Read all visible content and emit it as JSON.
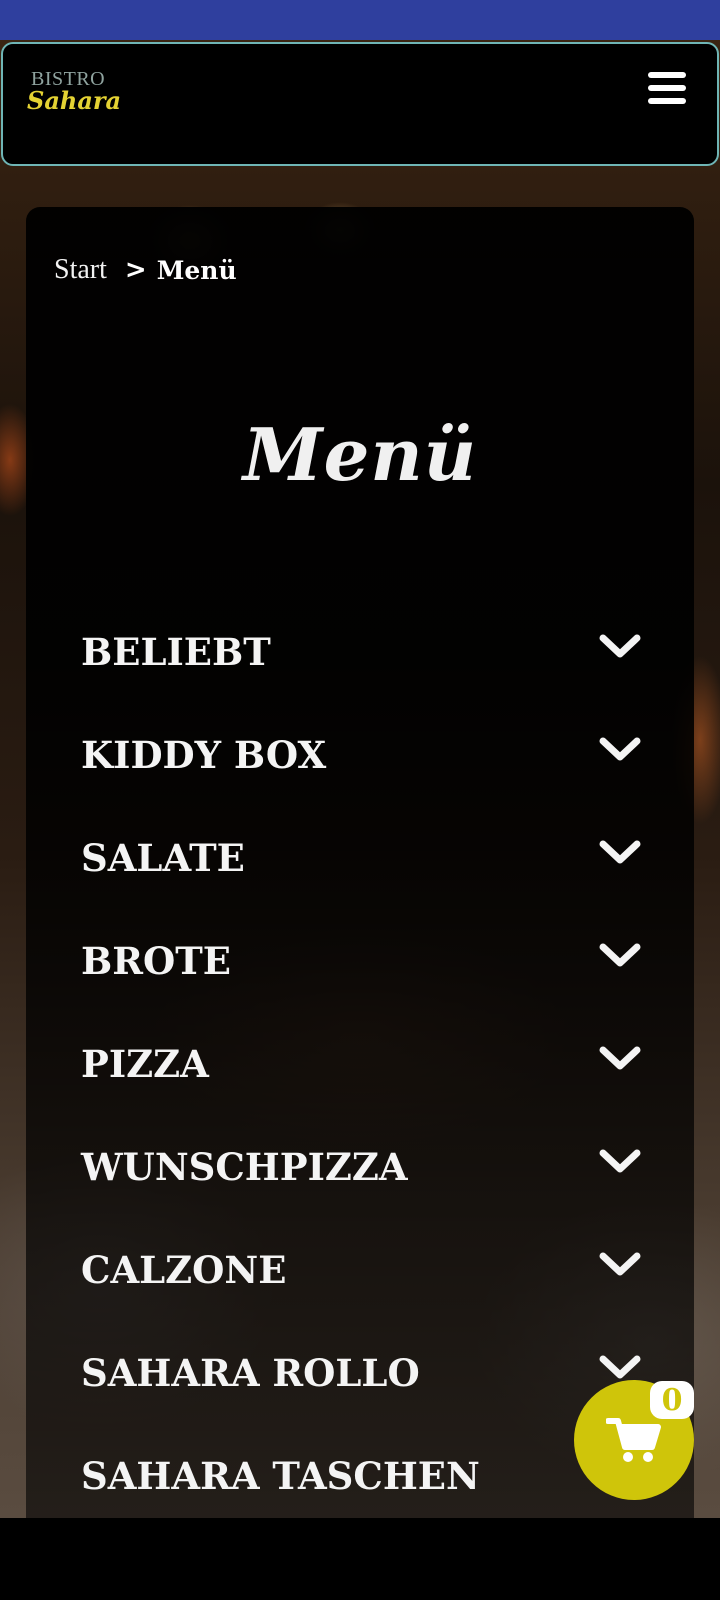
{
  "header": {
    "logo_top": "BISTRO",
    "logo_bottom": "Sahara",
    "menu_icon": "hamburger-icon"
  },
  "breadcrumb": {
    "start": "Start",
    "separator": ">",
    "current": "Menü"
  },
  "page": {
    "title": "Menü"
  },
  "menu": {
    "items": [
      {
        "label": "BELIEBT",
        "icon": "chevron-down-icon"
      },
      {
        "label": "KIDDY BOX",
        "icon": "chevron-down-icon"
      },
      {
        "label": "SALATE",
        "icon": "chevron-down-icon"
      },
      {
        "label": "BROTE",
        "icon": "chevron-down-icon"
      },
      {
        "label": "PIZZA",
        "icon": "chevron-down-icon"
      },
      {
        "label": "WUNSCHPIZZA",
        "icon": "chevron-down-icon"
      },
      {
        "label": "CALZONE",
        "icon": "chevron-down-icon"
      },
      {
        "label": "SAHARA ROLLO",
        "icon": "chevron-down-icon"
      },
      {
        "label": "SAHARA TASCHEN",
        "icon": "chevron-down-icon"
      }
    ]
  },
  "cart": {
    "count": "0",
    "icon": "cart-icon"
  },
  "colors": {
    "status_bar": "#2f3f9e",
    "header_border": "#6fb5b5",
    "logo_accent": "#e4d233",
    "cart_button": "#cfc50a"
  }
}
